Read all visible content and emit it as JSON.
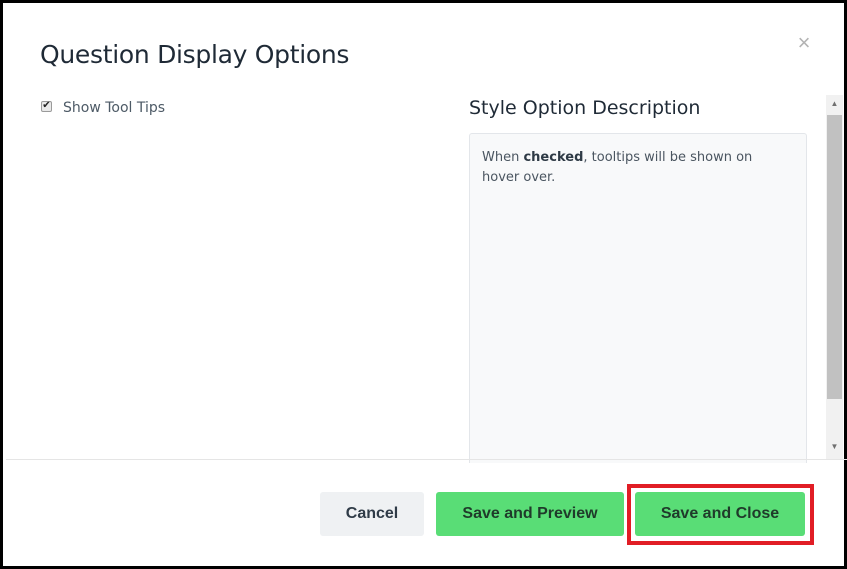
{
  "dialog": {
    "title": "Question Display Options",
    "close_icon": "close-icon",
    "close_glyph": "×"
  },
  "options": [
    {
      "label": "Show Tool Tips",
      "checked": true,
      "check_glyph": "✔"
    }
  ],
  "description": {
    "title": "Style Option Description",
    "text_before": "When ",
    "text_bold": "checked",
    "text_after": ", tooltips will be shown on hover over."
  },
  "scrollbar": {
    "up_glyph": "▲",
    "down_glyph": "▼"
  },
  "footer": {
    "cancel_label": "Cancel",
    "preview_label": "Save and Preview",
    "save_close_label": "Save and Close"
  },
  "colors": {
    "primary_button": "#59dd76",
    "highlight": "#e11d25"
  }
}
